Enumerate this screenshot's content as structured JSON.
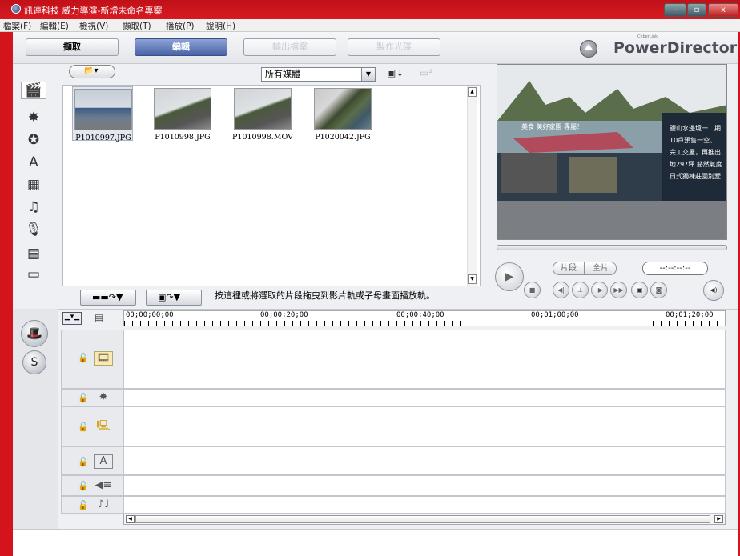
{
  "window": {
    "title": "訊連科技 威力導演-新增未命名專案",
    "buttons": {
      "minimize": "–",
      "maximize": "▫",
      "close": "x"
    }
  },
  "menu": [
    "檔案(F)",
    "編輯(E)",
    "檢視(V)",
    "擷取(T)",
    "播放(P)",
    "說明(H)"
  ],
  "tabs": [
    {
      "label": "擷取",
      "state": "normal"
    },
    {
      "label": "編輯",
      "state": "active"
    },
    {
      "label": "輸出檔案",
      "state": "disabled"
    },
    {
      "label": "製作光碟",
      "state": "disabled"
    }
  ],
  "brand": {
    "name": "PowerDirector",
    "prefix": "CyberLink"
  },
  "library": {
    "media_filter": "所有媒體",
    "items": [
      {
        "name": "P1010997.JPG",
        "selected": true
      },
      {
        "name": "P1010998.JPG",
        "selected": false
      },
      {
        "name": "P1010998.MOV",
        "selected": false
      },
      {
        "name": "P1020042.JPG",
        "selected": false
      }
    ],
    "hint": "按這裡或將選取的片段拖曳到影片軌或子母畫面播放軌。"
  },
  "player": {
    "clip_label": "片段",
    "movie_label": "全片",
    "timecode": "--:--:--:--",
    "billboard_lines": [
      "鹽山水邊境一二期",
      "10戶預售一空、",
      "完工交屋，再推出",
      "地297坪 豁然氣度",
      "日式獨棟莊園別墅"
    ],
    "banner_text": "美食 美好家園 專屬！"
  },
  "timeline": {
    "ruler": [
      "00;00;00;00",
      "00;00;20;00",
      "00;00;40;00",
      "00;01;00;00",
      "00;01;20;00"
    ]
  },
  "colors": {
    "desktop": "#d4141c",
    "accent": "#4a63a7",
    "panel": "#eef0f3"
  }
}
